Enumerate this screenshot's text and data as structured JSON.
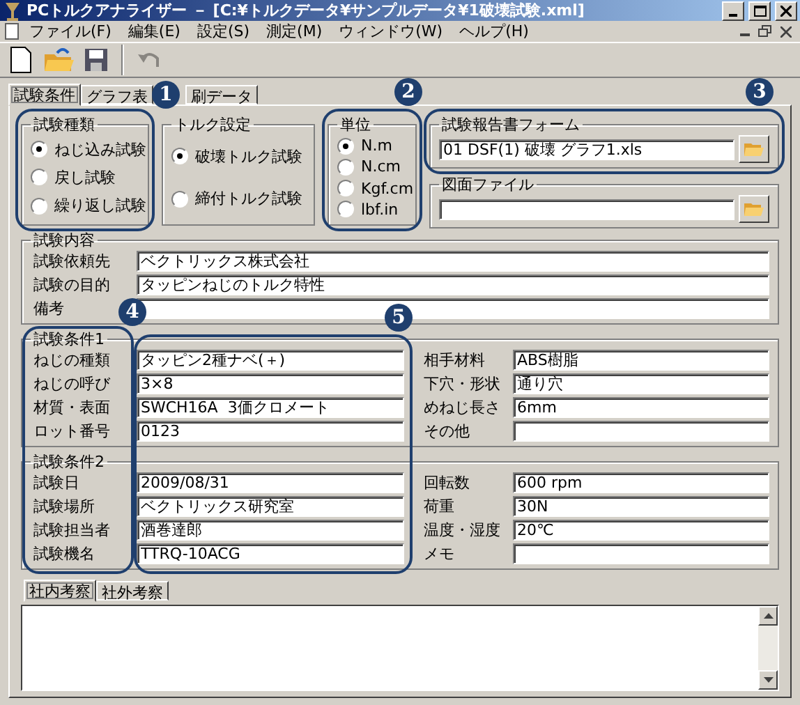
{
  "window": {
    "title": "PCトルクアナライザー － [C:¥トルクデータ¥サンプルデータ¥1破壊試験.xml]"
  },
  "menu": [
    {
      "label": "ファイル(F)"
    },
    {
      "label": "編集(E)"
    },
    {
      "label": "設定(S)"
    },
    {
      "label": "測定(M)"
    },
    {
      "label": "ウィンドウ(W)"
    },
    {
      "label": "ヘルプ(H)"
    }
  ],
  "toolbar": [
    {
      "kind": "new",
      "disabled": false
    },
    {
      "kind": "open",
      "disabled": false
    },
    {
      "kind": "save",
      "disabled": false
    },
    {
      "kind": "undo",
      "disabled": true
    }
  ],
  "tabs": [
    {
      "label": "試験条件",
      "selected": true
    },
    {
      "label": "グラフ表",
      "selected": false
    },
    {
      "label": "刷データ",
      "selected": false
    }
  ],
  "test_type": {
    "title": "試験種類",
    "options": [
      {
        "label": "ねじ込み試験",
        "selected": true
      },
      {
        "label": "戻し試験",
        "selected": false
      },
      {
        "label": "繰り返し試験",
        "selected": false
      }
    ]
  },
  "torque_setting": {
    "title": "トルク設定",
    "options": [
      {
        "label": "破壊トルク試験",
        "selected": true
      },
      {
        "label": "締付トルク試験",
        "selected": false
      }
    ]
  },
  "unit": {
    "title": "単位",
    "options": [
      {
        "label": "N.m",
        "selected": true
      },
      {
        "label": "N.cm",
        "selected": false
      },
      {
        "label": "Kgf.cm",
        "selected": false
      },
      {
        "label": "lbf.in",
        "selected": false
      }
    ]
  },
  "report_form": {
    "title": "試験報告書フォーム",
    "value": "01 DSF(1) 破壊 グラフ1.xls"
  },
  "drawing_file": {
    "title": "図面ファイル"
  },
  "test_content": {
    "title": "試験内容",
    "rows": [
      {
        "label": "試験依頼先",
        "value": "ベクトリックス株式会社"
      },
      {
        "label": "試験の目的",
        "value": "タッピンねじのトルク特性"
      },
      {
        "label": "備考"
      }
    ]
  },
  "conditions": [
    {
      "title": "試験条件1",
      "left": [
        {
          "label": "ねじの種類",
          "value": "タッピン2種ナベ(＋)"
        },
        {
          "label": "ねじの呼び",
          "value": "3×8"
        },
        {
          "label": "材質・表面",
          "value": "SWCH16A  3価クロメート"
        },
        {
          "label": "ロット番号",
          "value": "0123"
        }
      ],
      "right": [
        {
          "label": "相手材料",
          "value": "ABS樹脂"
        },
        {
          "label": "下穴・形状",
          "value": "通り穴"
        },
        {
          "label": "めねじ長さ",
          "value": "6mm"
        },
        {
          "label": "その他"
        }
      ]
    },
    {
      "title": "試験条件2",
      "left": [
        {
          "label": "試験日",
          "value": "2009/08/31"
        },
        {
          "label": "試験場所",
          "value": "ベクトリックス研究室"
        },
        {
          "label": "試験担当者",
          "value": "酒巻達郎"
        },
        {
          "label": "試験機名",
          "value": "TTRQ-10ACG"
        }
      ],
      "right": [
        {
          "label": "回転数",
          "value": "600 rpm"
        },
        {
          "label": "荷重",
          "value": "30N"
        },
        {
          "label": "温度・湿度",
          "value": "20℃"
        },
        {
          "label": "メモ"
        }
      ]
    }
  ],
  "notes_tabs": [
    {
      "label": "社内考察",
      "selected": true
    },
    {
      "label": "社外考察",
      "selected": false
    }
  ],
  "callouts": [
    {
      "number": "1"
    },
    {
      "number": "2"
    },
    {
      "number": "3"
    },
    {
      "number": "4"
    },
    {
      "number": "5"
    }
  ]
}
